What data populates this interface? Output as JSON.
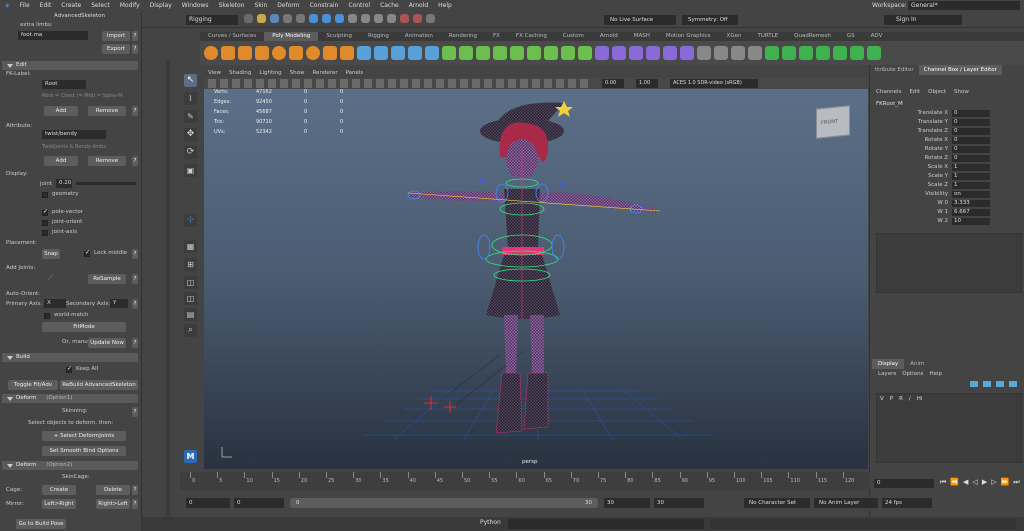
{
  "menubar": {
    "items": [
      "File",
      "Edit",
      "Create",
      "Select",
      "Modify",
      "Display",
      "Windows",
      "Skeleton",
      "Skin",
      "Deform",
      "Constrain",
      "Control",
      "Cache",
      "Arnold",
      "Help"
    ]
  },
  "status": {
    "mode": "Rigging",
    "live_surface": "No Live Surface",
    "symmetry": "Symmetry: Off",
    "workspace_label": "Workspace:",
    "workspace_value": "General*",
    "sign_in": "Sign In"
  },
  "shelf": {
    "tabs": [
      "Curves / Surfaces",
      "Poly Modeling",
      "Sculpting",
      "Rigging",
      "Animation",
      "Rendering",
      "FX",
      "FX Caching",
      "Custom",
      "Arnold",
      "MASH",
      "Motion Graphics",
      "XGen",
      "TURTLE",
      "QuadRemesh",
      "GS",
      "ADV"
    ],
    "active_tab": "Poly Modeling"
  },
  "left_panel": {
    "title": "AdvancedSkeleton",
    "extra_limbs": "extra limbs:",
    "foot_field": "foot.ma",
    "import": "Import",
    "export": "Export",
    "edit_section": "Edit",
    "fk_label": "FK-Label:",
    "root_select": "Root",
    "root_hint": "Root = Chest (= Mid) = Spine-M",
    "add": "Add",
    "remove": "Remove",
    "attribute_label": "Attribute:",
    "twist_select": "twist/bendy",
    "twist_hint": "TwistJoints & Bendy-limbs",
    "display_label": "Display:",
    "joint_label": "joint",
    "joint_value": "0.20",
    "geometry": "geometry",
    "pole_vector": "pole-vector",
    "joint_orient": "joint-orient",
    "joint_axis": "joint-axis",
    "placement_label": "Placement:",
    "snap": "Snap",
    "lock_middle": "Lock middle",
    "add_joints": "Add Joints:",
    "resample": "ReSample",
    "auto_orient": "Auto-Orient:",
    "primary_axis": "Primary Axis:",
    "primary_value": "X",
    "secondary_axis": "Secondary Axis:",
    "secondary_value": "Y",
    "world_match": "world-match",
    "fit_mode": "FitMode",
    "or_manual": "Or, manual:",
    "update_now": "Update Now",
    "build_section": "Build",
    "keep_all": "Keep All",
    "toggle_fit": "Toggle Fit/Adv",
    "rebuild": "ReBuild AdvancedSkeleton",
    "deform1_section": "Deform",
    "deform1_option": "(Option1)",
    "skinning": "Skinning:",
    "select_objects": "Select objects to deform, then:",
    "select_deform_joints": "+ Select DeformJoints",
    "smooth_bind": "Set Smooth Bind Options",
    "deform2_section": "Deform",
    "deform2_option": "(Option2)",
    "skincage": "SkinCage:",
    "cage": "Cage:",
    "create": "Create",
    "delete": "Delete",
    "mirror": "Mirror:",
    "left_right": "Left>Right",
    "right_left": "Right>Left",
    "go_build_pose": "Go to Build Pose"
  },
  "viewport": {
    "menu": [
      "View",
      "Shading",
      "Lighting",
      "Show",
      "Renderer",
      "Panels"
    ],
    "hud_labels": [
      "Verts:",
      "Edges:",
      "Faces:",
      "Tris:",
      "UVs:"
    ],
    "hud_values": [
      "47162",
      "92450",
      "45687",
      "90710",
      "52342"
    ],
    "hud_zero": "0",
    "exposure": "0.00",
    "gamma": "1.00",
    "color_space": "ACES 1.0 SDR-video (sRGB)",
    "camera": "persp",
    "viewcube": "FRONT"
  },
  "channel_box": {
    "tab_attr": "ttribute Editor",
    "tab_channel": "Channel Box / Layer Editor",
    "menu": [
      "Channels",
      "Edit",
      "Object",
      "Show"
    ],
    "object": "FKRoot_M",
    "channels": [
      {
        "name": "Translate X",
        "value": "0"
      },
      {
        "name": "Translate Y",
        "value": "0"
      },
      {
        "name": "Translate Z",
        "value": "0"
      },
      {
        "name": "Rotate X",
        "value": "0"
      },
      {
        "name": "Rotate Y",
        "value": "0"
      },
      {
        "name": "Rotate Z",
        "value": "0"
      },
      {
        "name": "Scale X",
        "value": "1"
      },
      {
        "name": "Scale Y",
        "value": "1"
      },
      {
        "name": "Scale Z",
        "value": "1"
      },
      {
        "name": "Visibility",
        "value": "on"
      },
      {
        "name": "W 0",
        "value": "3.333"
      },
      {
        "name": "W 1",
        "value": "6.667"
      },
      {
        "name": "W 2",
        "value": "10"
      }
    ],
    "layer_tabs": [
      "Display",
      "Anim"
    ],
    "layer_menu": [
      "Layers",
      "Options",
      "Help"
    ],
    "layer_row": [
      "V",
      "P",
      "R",
      "/",
      "Hi"
    ]
  },
  "timeline": {
    "ticks": [
      "0",
      "5",
      "10",
      "15",
      "20",
      "25",
      "30",
      "35",
      "40",
      "45",
      "50",
      "55",
      "60",
      "65",
      "70",
      "75",
      "80",
      "85",
      "90",
      "95",
      "100",
      "105",
      "110",
      "115",
      "120"
    ],
    "current_frame": "0",
    "range_start": "0",
    "range_start2": "0",
    "range_slider_start": "0",
    "range_slider_end": "30",
    "range_end": "30",
    "range_end2": "30",
    "char_set": "No Character Set",
    "anim_layer": "No Anim Layer",
    "fps": "24 fps"
  },
  "command_line": {
    "label": "Python"
  },
  "colors": {
    "accent": "#4a8fd8",
    "rig_green": "#2ee87a",
    "rig_pink": "#ff2d8a",
    "rig_blue": "#3a8cff"
  }
}
